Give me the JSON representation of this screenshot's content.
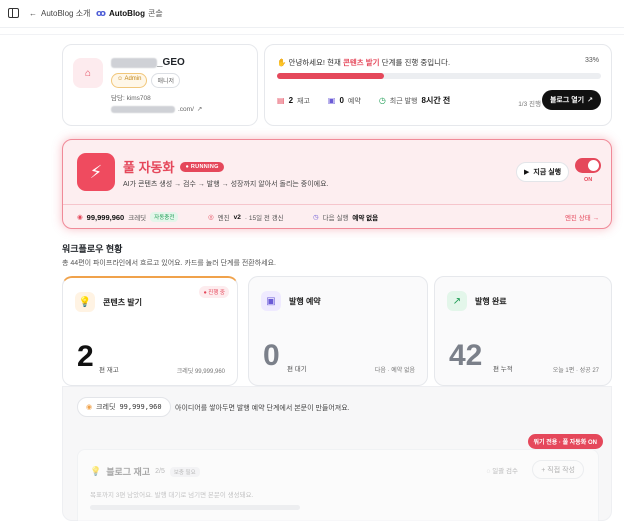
{
  "topbar": {
    "back_label": "AutoBlog 소개",
    "brand": "AutoBlog",
    "brand_suffix": "콘솔"
  },
  "profile": {
    "name_suffix": "_GEO",
    "badge_admin": "Admin",
    "badge_role": "매니저",
    "owner": "담당: kims708",
    "url_suffix": ".com/"
  },
  "progress": {
    "message_before": "안녕하세요! 현재 ",
    "message_highlight": "콘텐츠 발기",
    "message_after": " 단계를 진행 중입니다.",
    "percent_label": "33%",
    "percent_value": 33,
    "stock_count": "2",
    "stock_label": "재고",
    "reserved_count": "0",
    "reserved_label": "예약",
    "last_label": "최근 발행",
    "last_value": "8시간 전",
    "step_label": "1/3 진행",
    "open_blog_label": "블로그 열기"
  },
  "automation": {
    "title": "풀 자동화",
    "status": "RUNNING",
    "description": "AI가 콘텐츠 생성 → 검수 → 발행 → 성장까지 알아서 돌리는 중이에요.",
    "run_now_label": "지금 실행",
    "toggle_label": "ON",
    "toggle_on": true,
    "credit_value": "99,999,960",
    "credit_label": "크레딧",
    "credit_tag": "자동충전",
    "engine_label": "엔진",
    "engine_version": "v2",
    "engine_updated": "· 15일 전 갱신",
    "next_run_label": "다음 실행",
    "next_run_value": "예약 없음",
    "engine_status_link": "엔진 상태 →"
  },
  "workflow": {
    "title": "워크플로우 현황",
    "subtitle": "총 44편이 파이프라인에서 흐르고 있어요. 카드를 눌러 단계를 전환하세요.",
    "stages": [
      {
        "label": "콘텐츠 발기",
        "badge": "● 진행 중",
        "count": "2",
        "unit": "편 재고",
        "right": "크레딧 99,999,960",
        "icon": "lightbulb-icon"
      },
      {
        "label": "발행 예약",
        "badge": "",
        "count": "0",
        "unit": "편 대기",
        "right": "다음 · 예약 없음",
        "icon": "calendar-icon"
      },
      {
        "label": "발행 완료",
        "badge": "",
        "count": "42",
        "unit": "편 누적",
        "right": "오늘 1편 · 성공 27",
        "icon": "trend-up-icon"
      }
    ]
  },
  "lower": {
    "credit_label": "크레딧",
    "credit_value": "99,999,960",
    "message": "아이디어를 쌓아두면 발행 예약 단계에서 본문이 만들어져요.",
    "mode_badge": "워기 전용 · 풀 자동화 ON",
    "stock_title": "블로그 재고",
    "stock_count": "2/5",
    "stock_tag": "보충 필요",
    "review_label": "일괄 검수",
    "write_label": "+ 직접 작성",
    "stock_desc": "목표까지 3편 남았어요. 발행 대기로 넘기면 본문이 생성돼요."
  },
  "colors": {
    "accent": "#e5485b",
    "accent_soft": "#fdeef0",
    "warning": "#f0a24b",
    "text": "#1f2328"
  }
}
